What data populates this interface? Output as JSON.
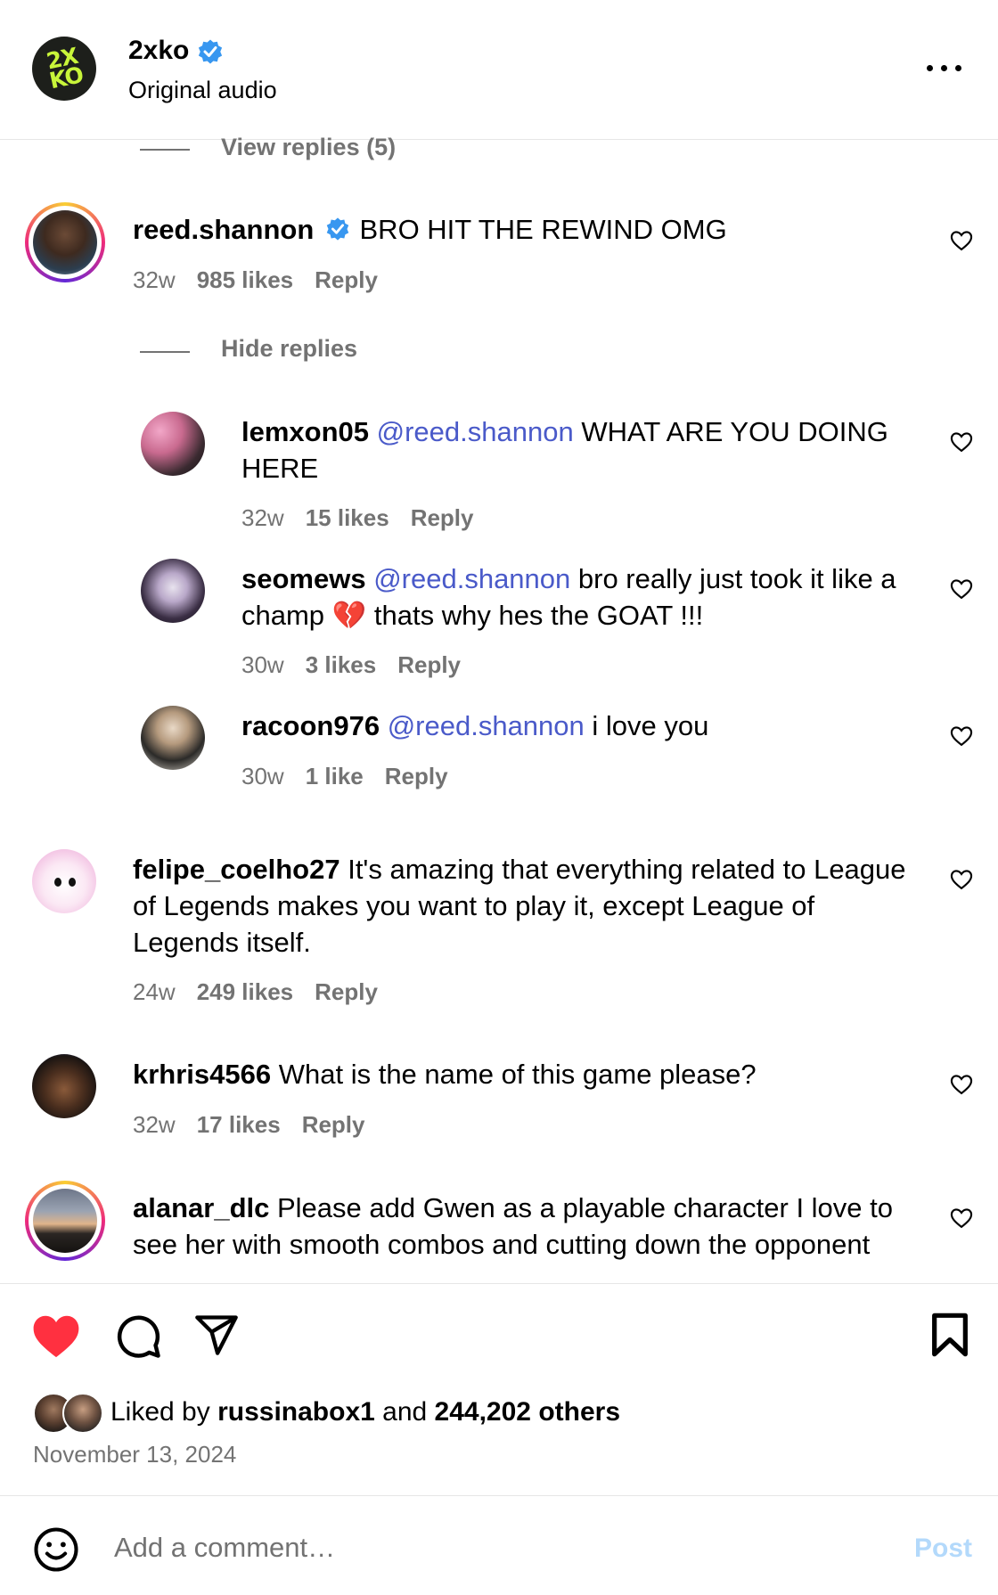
{
  "header": {
    "logo_text_top": "2X",
    "logo_text_bottom": "KO",
    "account_name": "2xko",
    "subtitle": "Original audio"
  },
  "top_view_replies": "View replies (5)",
  "comments": [
    {
      "user": "reed.shannon",
      "verified": true,
      "text": " BRO HIT THE REWIND OMG",
      "time": "32w",
      "likes": "985 likes",
      "reply": "Reply",
      "hide_replies": "Hide replies",
      "replies": [
        {
          "user": "lemxon05",
          "mention": "@reed.shannon",
          "text": " WHAT ARE YOU DOING HERE",
          "time": "32w",
          "likes": "15 likes",
          "reply": "Reply"
        },
        {
          "user": "seomews",
          "mention": "@reed.shannon",
          "text": " bro really just took it like a champ ",
          "emoji": "💔",
          "text2": " thats why hes the GOAT !!!",
          "time": "30w",
          "likes": "3 likes",
          "reply": "Reply"
        },
        {
          "user": "racoon976",
          "mention": "@reed.shannon",
          "text": " i love you",
          "time": "30w",
          "likes": "1 like",
          "reply": "Reply"
        }
      ]
    },
    {
      "user": "felipe_coelho27",
      "text": " It's amazing that everything related to League of Legends makes you want to play it, except League of Legends itself.",
      "time": "24w",
      "likes": "249 likes",
      "reply": "Reply"
    },
    {
      "user": "krhris4566",
      "text": " What is the name of this game please?",
      "time": "32w",
      "likes": "17 likes",
      "reply": "Reply"
    },
    {
      "user": "alanar_dlc",
      "text": " Please add Gwen as a playable character I love to see her with smooth combos and cutting down the opponent"
    }
  ],
  "footer": {
    "liked_prefix": "Liked by ",
    "liked_user": "russinabox1",
    "liked_mid": " and ",
    "liked_count": "244,202 others",
    "date": "November 13, 2024",
    "comment_placeholder": "Add a comment…",
    "post_label": "Post"
  },
  "colors": {
    "accent_blue": "#4a5ac9",
    "verified_blue": "#3897f0",
    "like_red": "#ff3040",
    "muted": "#737373"
  }
}
